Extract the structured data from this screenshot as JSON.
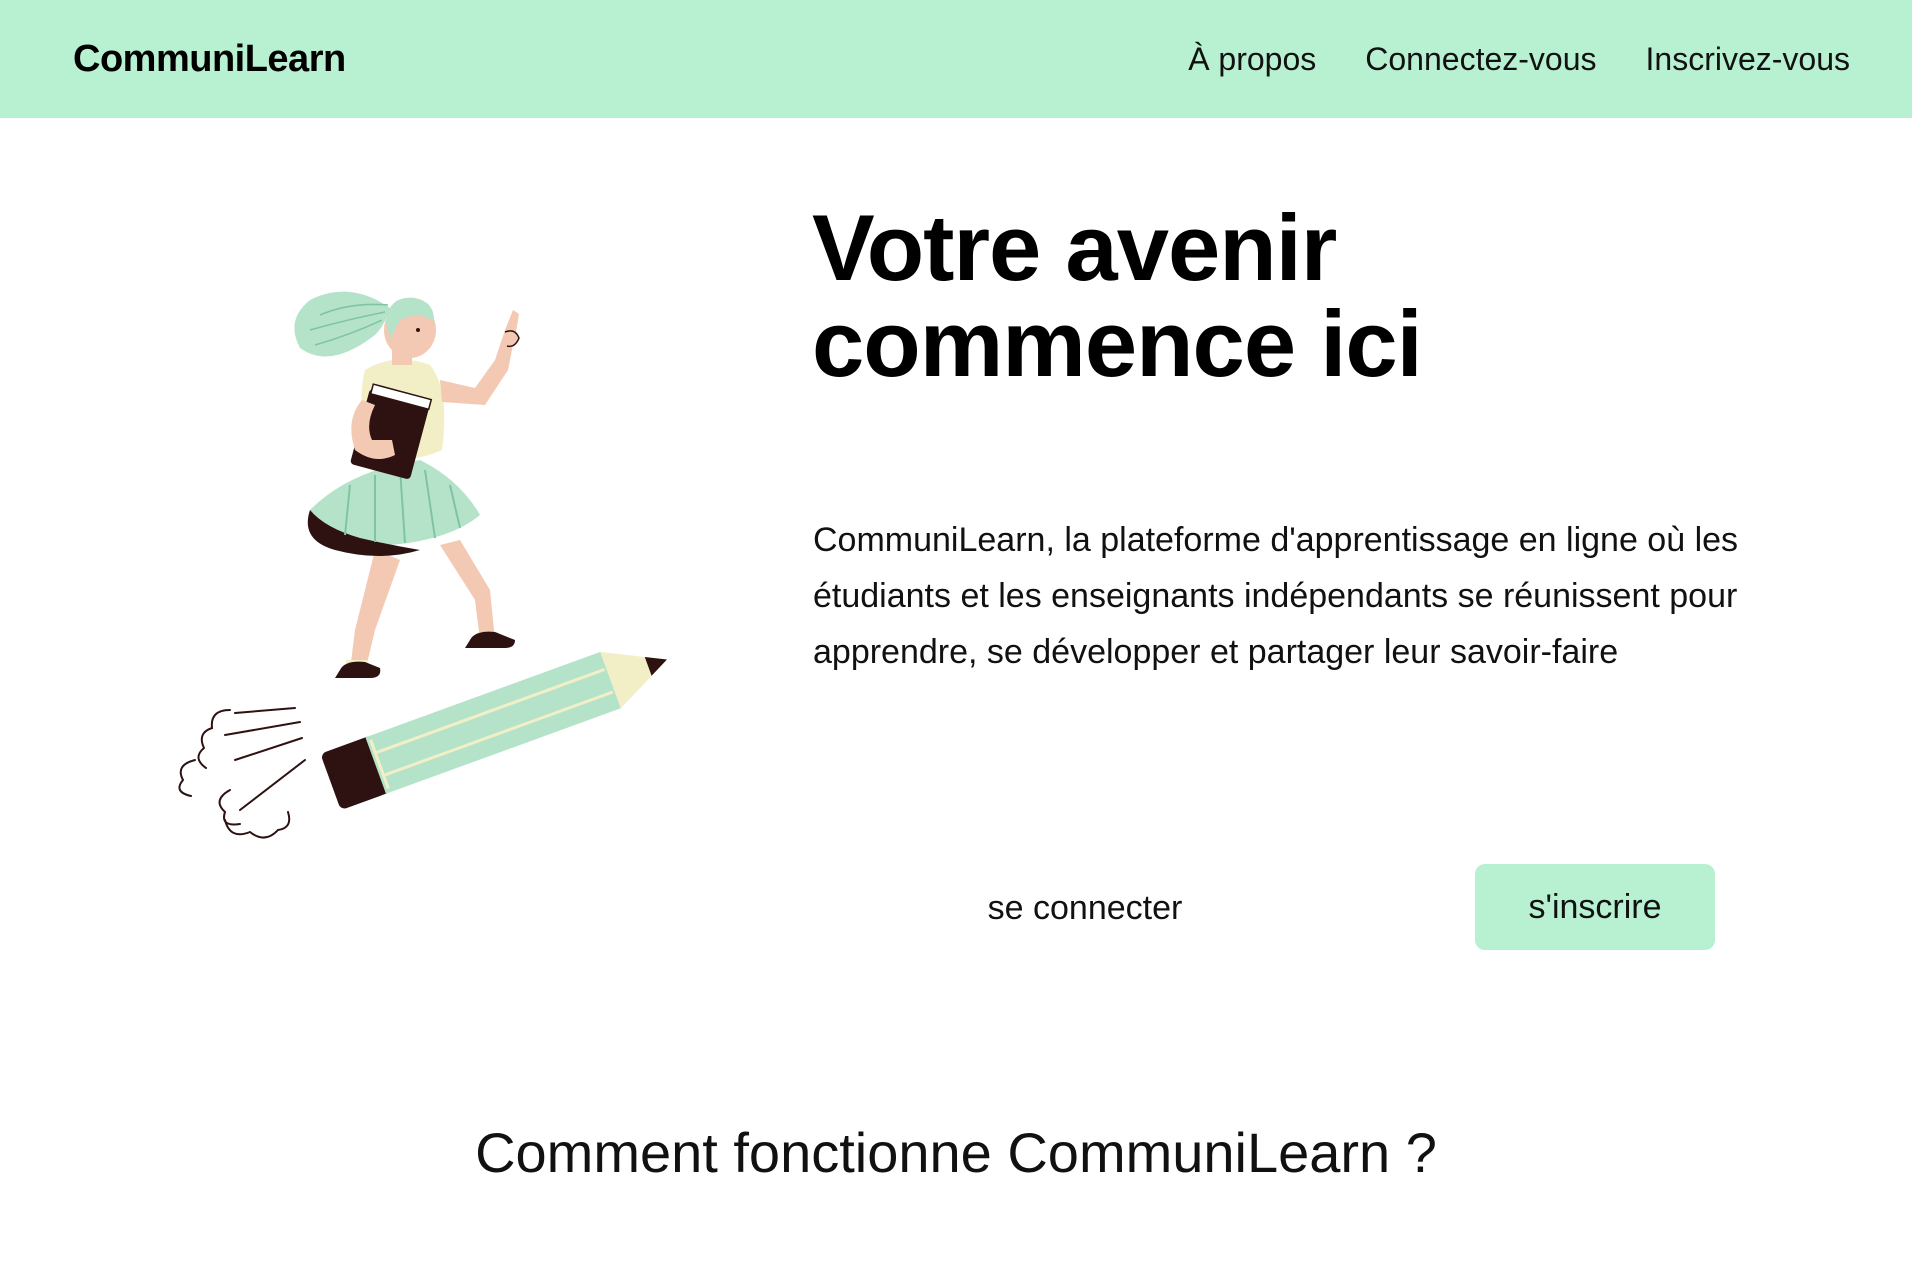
{
  "navbar": {
    "brand": "CommuniLearn",
    "links": [
      {
        "label": "À propos"
      },
      {
        "label": "Connectez-vous"
      },
      {
        "label": "Inscrivez-vous"
      }
    ]
  },
  "hero": {
    "title_line1": "Votre avenir",
    "title_line2": "commence ici",
    "description": "CommuniLearn, la plateforme d'apprentissage en ligne où les étudiants et les enseignants indépendants se réunissent pour apprendre, se développer et partager leur savoir-faire",
    "illustration": "girl-riding-pencil-illustration",
    "login_label": "se connecter",
    "signup_label": "s'inscrire"
  },
  "how_it_works": {
    "title": "Comment fonctionne CommuniLearn ?"
  },
  "colors": {
    "accent": "#b8f0d2",
    "mint": "#b5e3c9",
    "cream": "#f2efc7",
    "skin": "#f4c9b3",
    "dark_brown": "#2e1212"
  }
}
